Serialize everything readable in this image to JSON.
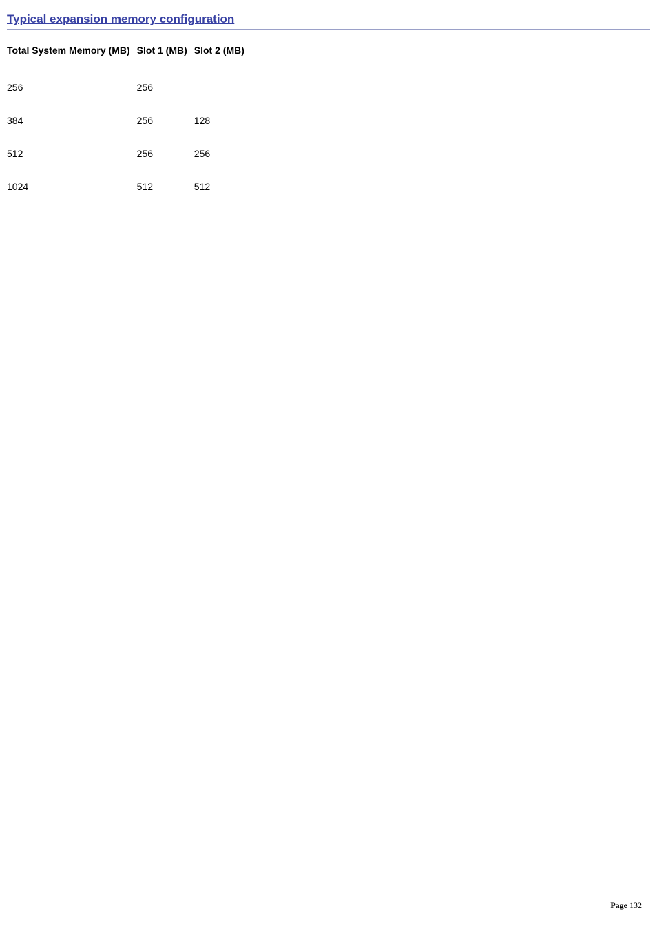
{
  "heading": "Typical expansion memory configuration",
  "table": {
    "headers": [
      "Total System Memory (MB)",
      "Slot 1 (MB)",
      "Slot 2 (MB)"
    ],
    "rows": [
      [
        "256",
        "256",
        ""
      ],
      [
        "384",
        "256",
        "128"
      ],
      [
        "512",
        "256",
        "256"
      ],
      [
        "1024",
        "512",
        "512"
      ]
    ]
  },
  "footer": {
    "label": "Page",
    "number": "132"
  }
}
